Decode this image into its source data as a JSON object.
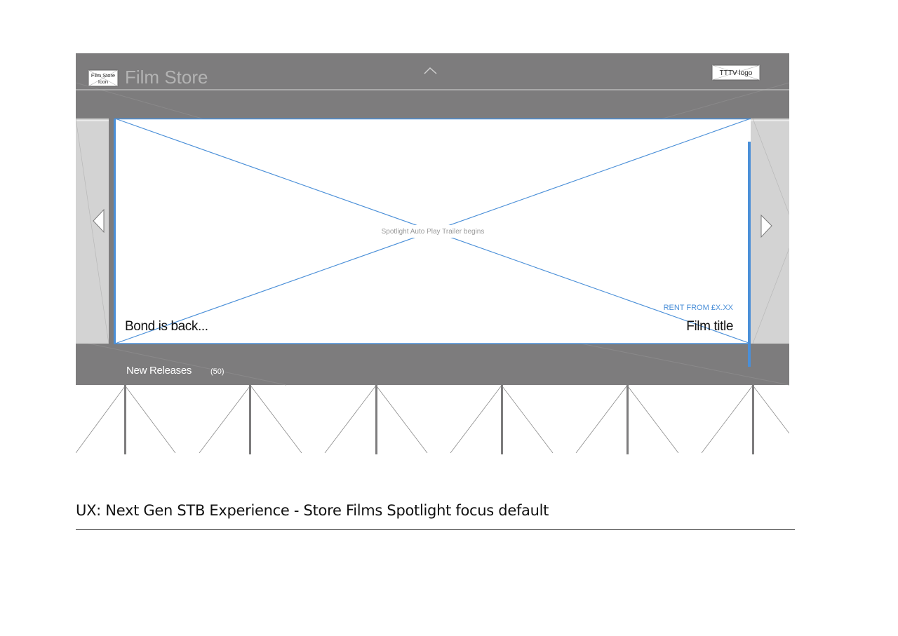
{
  "header": {
    "store_icon_placeholder": [
      "Film Store",
      "Icon"
    ],
    "title": "Film Store",
    "provider_logo_placeholder": "TTTV logo"
  },
  "spotlight": {
    "placeholder_text": "Spotlight Auto Play Trailer begins",
    "tagline": "Bond is back...",
    "price_text": "RENT FROM £X.XX",
    "film_title": "Film title"
  },
  "rail": {
    "title": "New Releases",
    "count": "(50)"
  },
  "caption": "UX: Next Gen STB Experience - Store Films Spotlight focus default",
  "colors": {
    "chrome": "#7d7c7d",
    "side_panel": "#d3d3d3",
    "focus_accent": "#4a8fd8",
    "divider": "#b8b8b8"
  }
}
